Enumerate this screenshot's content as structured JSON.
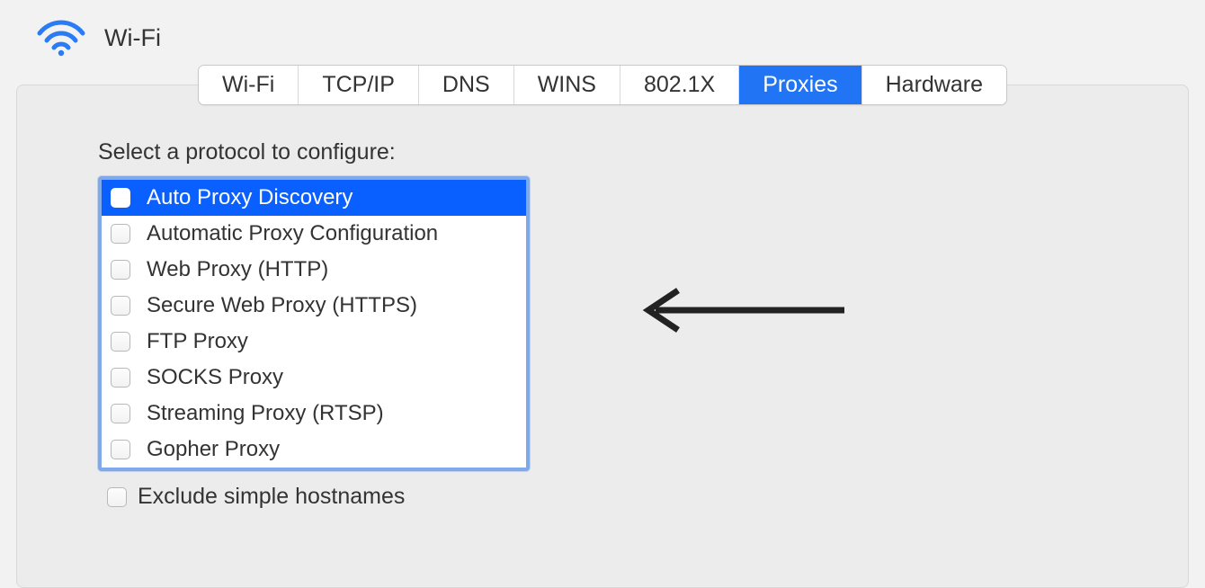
{
  "header": {
    "title": "Wi-Fi"
  },
  "tabs": {
    "items": [
      {
        "label": "Wi-Fi",
        "active": false
      },
      {
        "label": "TCP/IP",
        "active": false
      },
      {
        "label": "DNS",
        "active": false
      },
      {
        "label": "WINS",
        "active": false
      },
      {
        "label": "802.1X",
        "active": false
      },
      {
        "label": "Proxies",
        "active": true
      },
      {
        "label": "Hardware",
        "active": false
      }
    ]
  },
  "section": {
    "label": "Select a protocol to configure:"
  },
  "protocols": {
    "items": [
      {
        "label": "Auto Proxy Discovery",
        "checked": false,
        "selected": true
      },
      {
        "label": "Automatic Proxy Configuration",
        "checked": false,
        "selected": false
      },
      {
        "label": "Web Proxy (HTTP)",
        "checked": false,
        "selected": false
      },
      {
        "label": "Secure Web Proxy (HTTPS)",
        "checked": false,
        "selected": false
      },
      {
        "label": "FTP Proxy",
        "checked": false,
        "selected": false
      },
      {
        "label": "SOCKS Proxy",
        "checked": false,
        "selected": false
      },
      {
        "label": "Streaming Proxy (RTSP)",
        "checked": false,
        "selected": false
      },
      {
        "label": "Gopher Proxy",
        "checked": false,
        "selected": false
      }
    ]
  },
  "exclude": {
    "label": "Exclude simple hostnames",
    "checked": false
  }
}
